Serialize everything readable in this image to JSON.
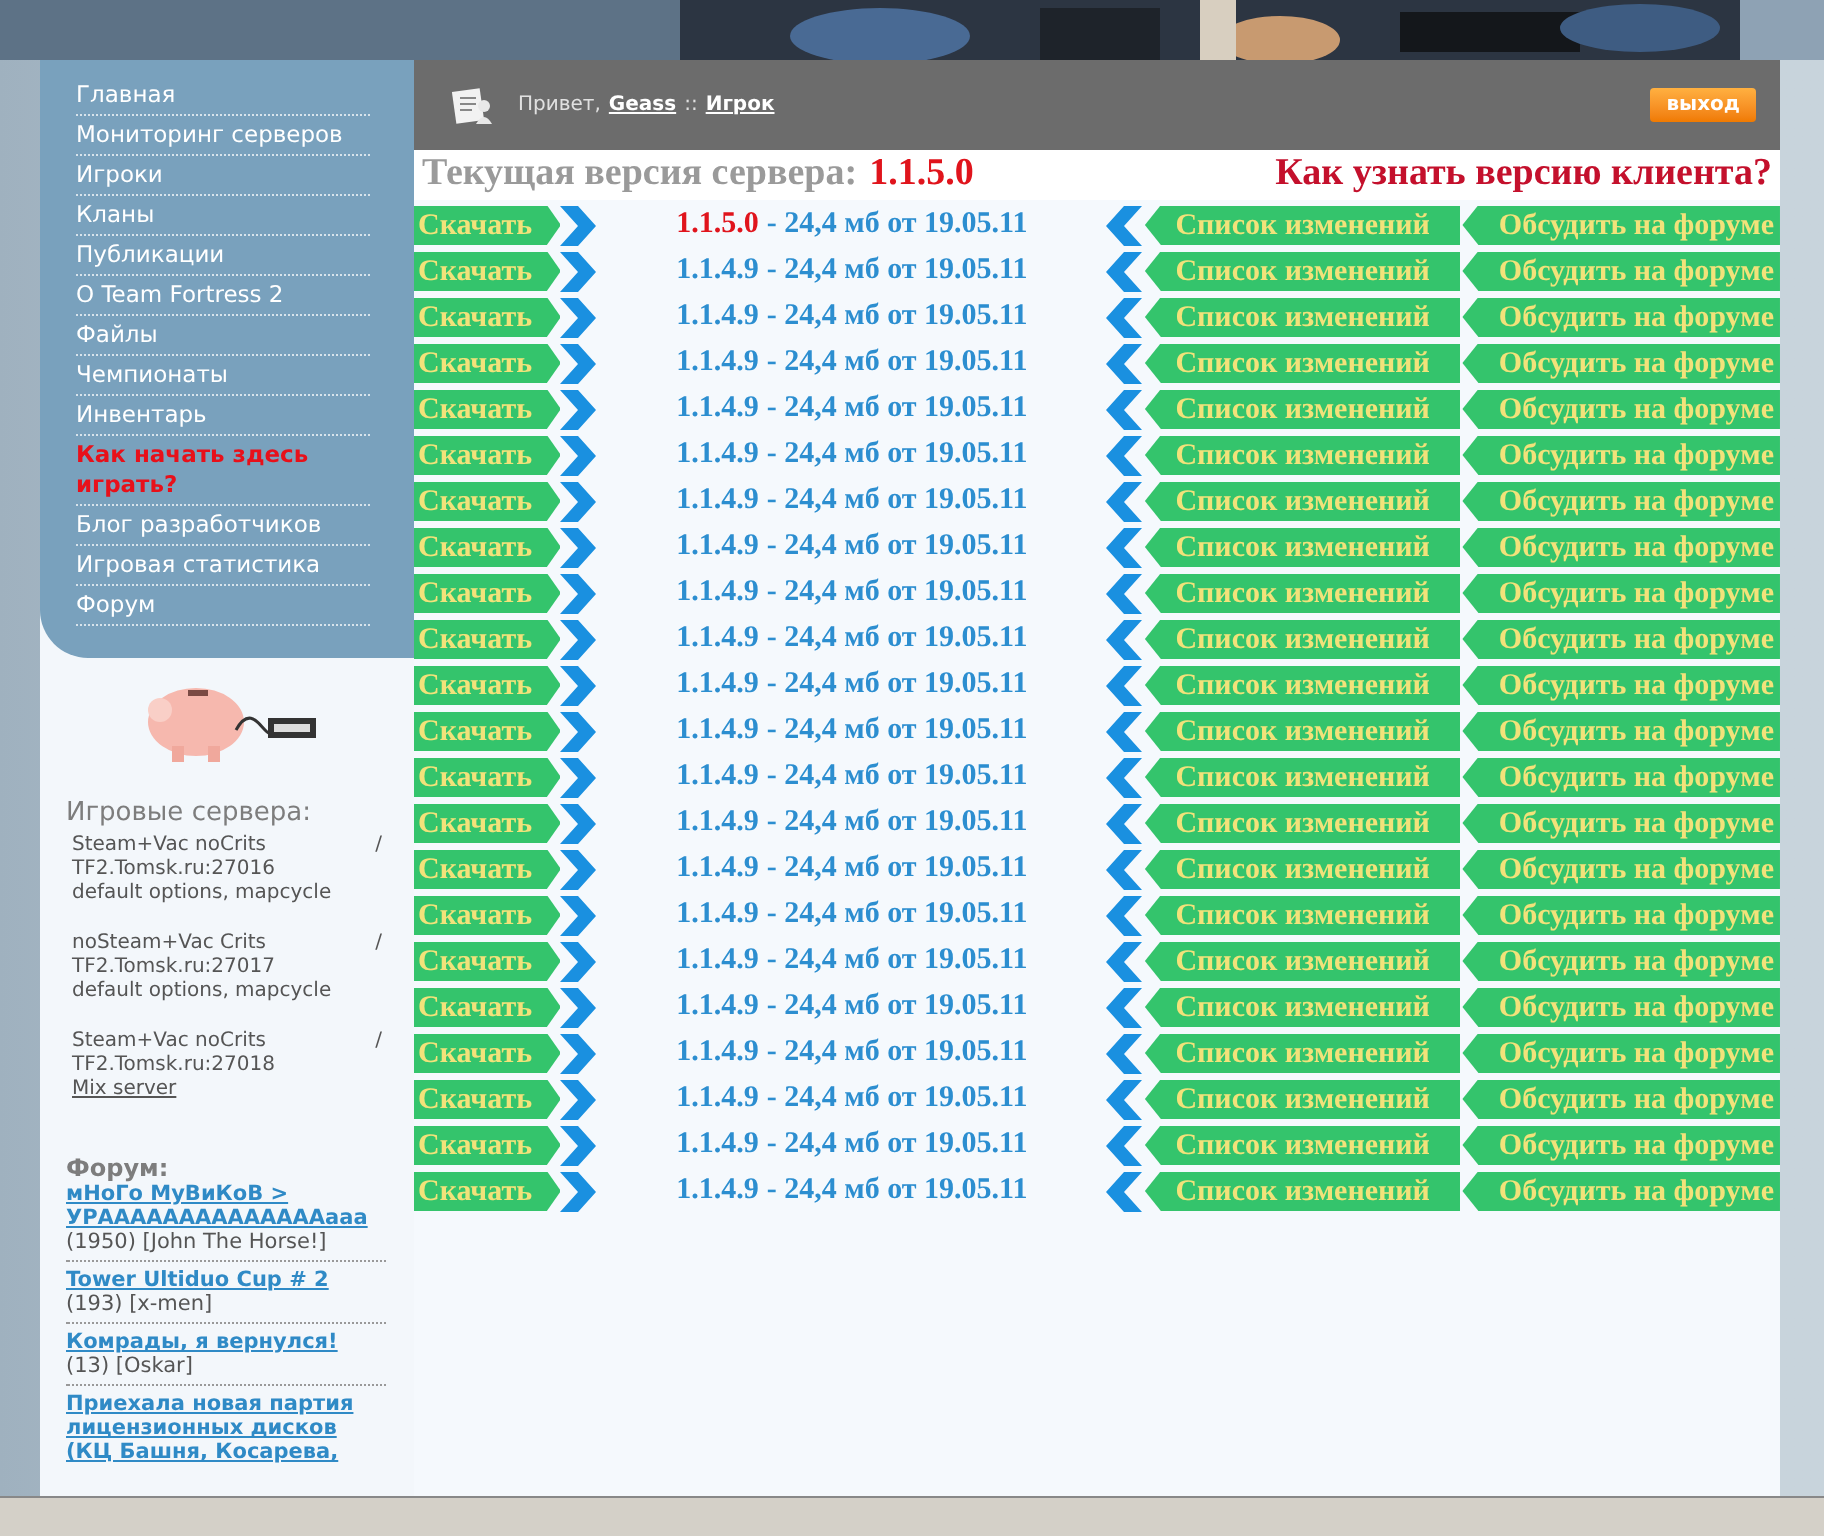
{
  "nav": {
    "items": [
      {
        "label": "Главная",
        "highlight": false
      },
      {
        "label": "Мониторинг серверов",
        "highlight": false
      },
      {
        "label": "Игроки",
        "highlight": false
      },
      {
        "label": "Кланы",
        "highlight": false
      },
      {
        "label": "Публикации",
        "highlight": false
      },
      {
        "label": "O Team Fortress 2",
        "highlight": false
      },
      {
        "label": "Файлы",
        "highlight": false
      },
      {
        "label": "Чемпионаты",
        "highlight": false
      },
      {
        "label": "Инвентарь",
        "highlight": false
      },
      {
        "label": "Как начать здесь играть?",
        "highlight": true
      },
      {
        "label": "Блог разработчиков",
        "highlight": false
      },
      {
        "label": "Игровая статистика",
        "highlight": false
      },
      {
        "label": "Форум",
        "highlight": false
      }
    ]
  },
  "user": {
    "greeting": "Привет,",
    "name": "Geass",
    "separator": "::",
    "role": "Игрок"
  },
  "logout": "выход",
  "current_version": {
    "label": "Текущая версия сервера:",
    "value": "1.1.5.0"
  },
  "client_version_link": "Как узнать версию клиента?",
  "downloads": [
    {
      "download": "Скачать",
      "version": "1.1.5.0",
      "latest": true,
      "info": "- 24,4 мб от 19.05.11",
      "changes": "Список изменений",
      "discuss": "Обсудить на форуме"
    },
    {
      "download": "Скачать",
      "version": "1.1.4.9",
      "latest": false,
      "info": "- 24,4 мб от 19.05.11",
      "changes": "Список изменений",
      "discuss": "Обсудить на форуме"
    },
    {
      "download": "Скачать",
      "version": "1.1.4.9",
      "latest": false,
      "info": "- 24,4 мб от 19.05.11",
      "changes": "Список изменений",
      "discuss": "Обсудить на форуме"
    },
    {
      "download": "Скачать",
      "version": "1.1.4.9",
      "latest": false,
      "info": "- 24,4 мб от 19.05.11",
      "changes": "Список изменений",
      "discuss": "Обсудить на форуме"
    },
    {
      "download": "Скачать",
      "version": "1.1.4.9",
      "latest": false,
      "info": "- 24,4 мб от 19.05.11",
      "changes": "Список изменений",
      "discuss": "Обсудить на форуме"
    },
    {
      "download": "Скачать",
      "version": "1.1.4.9",
      "latest": false,
      "info": "- 24,4 мб от 19.05.11",
      "changes": "Список изменений",
      "discuss": "Обсудить на форуме"
    },
    {
      "download": "Скачать",
      "version": "1.1.4.9",
      "latest": false,
      "info": "- 24,4 мб от 19.05.11",
      "changes": "Список изменений",
      "discuss": "Обсудить на форуме"
    },
    {
      "download": "Скачать",
      "version": "1.1.4.9",
      "latest": false,
      "info": "- 24,4 мб от 19.05.11",
      "changes": "Список изменений",
      "discuss": "Обсудить на форуме"
    },
    {
      "download": "Скачать",
      "version": "1.1.4.9",
      "latest": false,
      "info": "- 24,4 мб от 19.05.11",
      "changes": "Список изменений",
      "discuss": "Обсудить на форуме"
    },
    {
      "download": "Скачать",
      "version": "1.1.4.9",
      "latest": false,
      "info": "- 24,4 мб от 19.05.11",
      "changes": "Список изменений",
      "discuss": "Обсудить на форуме"
    },
    {
      "download": "Скачать",
      "version": "1.1.4.9",
      "latest": false,
      "info": "- 24,4 мб от 19.05.11",
      "changes": "Список изменений",
      "discuss": "Обсудить на форуме"
    },
    {
      "download": "Скачать",
      "version": "1.1.4.9",
      "latest": false,
      "info": "- 24,4 мб от 19.05.11",
      "changes": "Список изменений",
      "discuss": "Обсудить на форуме"
    },
    {
      "download": "Скачать",
      "version": "1.1.4.9",
      "latest": false,
      "info": "- 24,4 мб от 19.05.11",
      "changes": "Список изменений",
      "discuss": "Обсудить на форуме"
    },
    {
      "download": "Скачать",
      "version": "1.1.4.9",
      "latest": false,
      "info": "- 24,4 мб от 19.05.11",
      "changes": "Список изменений",
      "discuss": "Обсудить на форуме"
    },
    {
      "download": "Скачать",
      "version": "1.1.4.9",
      "latest": false,
      "info": "- 24,4 мб от 19.05.11",
      "changes": "Список изменений",
      "discuss": "Обсудить на форуме"
    },
    {
      "download": "Скачать",
      "version": "1.1.4.9",
      "latest": false,
      "info": "- 24,4 мб от 19.05.11",
      "changes": "Список изменений",
      "discuss": "Обсудить на форуме"
    },
    {
      "download": "Скачать",
      "version": "1.1.4.9",
      "latest": false,
      "info": "- 24,4 мб от 19.05.11",
      "changes": "Список изменений",
      "discuss": "Обсудить на форуме"
    },
    {
      "download": "Скачать",
      "version": "1.1.4.9",
      "latest": false,
      "info": "- 24,4 мб от 19.05.11",
      "changes": "Список изменений",
      "discuss": "Обсудить на форуме"
    },
    {
      "download": "Скачать",
      "version": "1.1.4.9",
      "latest": false,
      "info": "- 24,4 мб от 19.05.11",
      "changes": "Список изменений",
      "discuss": "Обсудить на форуме"
    },
    {
      "download": "Скачать",
      "version": "1.1.4.9",
      "latest": false,
      "info": "- 24,4 мб от 19.05.11",
      "changes": "Список изменений",
      "discuss": "Обсудить на форуме"
    },
    {
      "download": "Скачать",
      "version": "1.1.4.9",
      "latest": false,
      "info": "- 24,4 мб от 19.05.11",
      "changes": "Список изменений",
      "discuss": "Обсудить на форуме"
    },
    {
      "download": "Скачать",
      "version": "1.1.4.9",
      "latest": false,
      "info": "- 24,4 мб от 19.05.11",
      "changes": "Список изменений",
      "discuss": "Обсудить на форуме"
    }
  ],
  "servers": {
    "title": "Игровые сервера:",
    "items": [
      {
        "name": "Steam+Vac noCrits",
        "players": "/",
        "address": "TF2.Tomsk.ru:27016",
        "note": "default options, mapcycle",
        "note_is_link": false
      },
      {
        "name": "noSteam+Vac Crits",
        "players": "/",
        "address": "TF2.Tomsk.ru:27017",
        "note": "default options, mapcycle",
        "note_is_link": false
      },
      {
        "name": "Steam+Vac noCrits",
        "players": "/",
        "address": "TF2.Tomsk.ru:27018",
        "note": "Mix server",
        "note_is_link": true
      }
    ]
  },
  "forum": {
    "title": "Форум:",
    "topics": [
      {
        "title": "мНоГо МуВиКоВ > УРААААААААААААААааа",
        "meta": "(1950) [John The Horse!]"
      },
      {
        "title": "Tower Ultiduo Cup # 2",
        "meta": "(193) [x-men]"
      },
      {
        "title": "Комрады, я вернулся!",
        "meta": "(13) [Oskar]"
      },
      {
        "title": "Приехала новая партия лицензионных дисков (КЦ Башня, Косарева,"
      }
    ]
  }
}
